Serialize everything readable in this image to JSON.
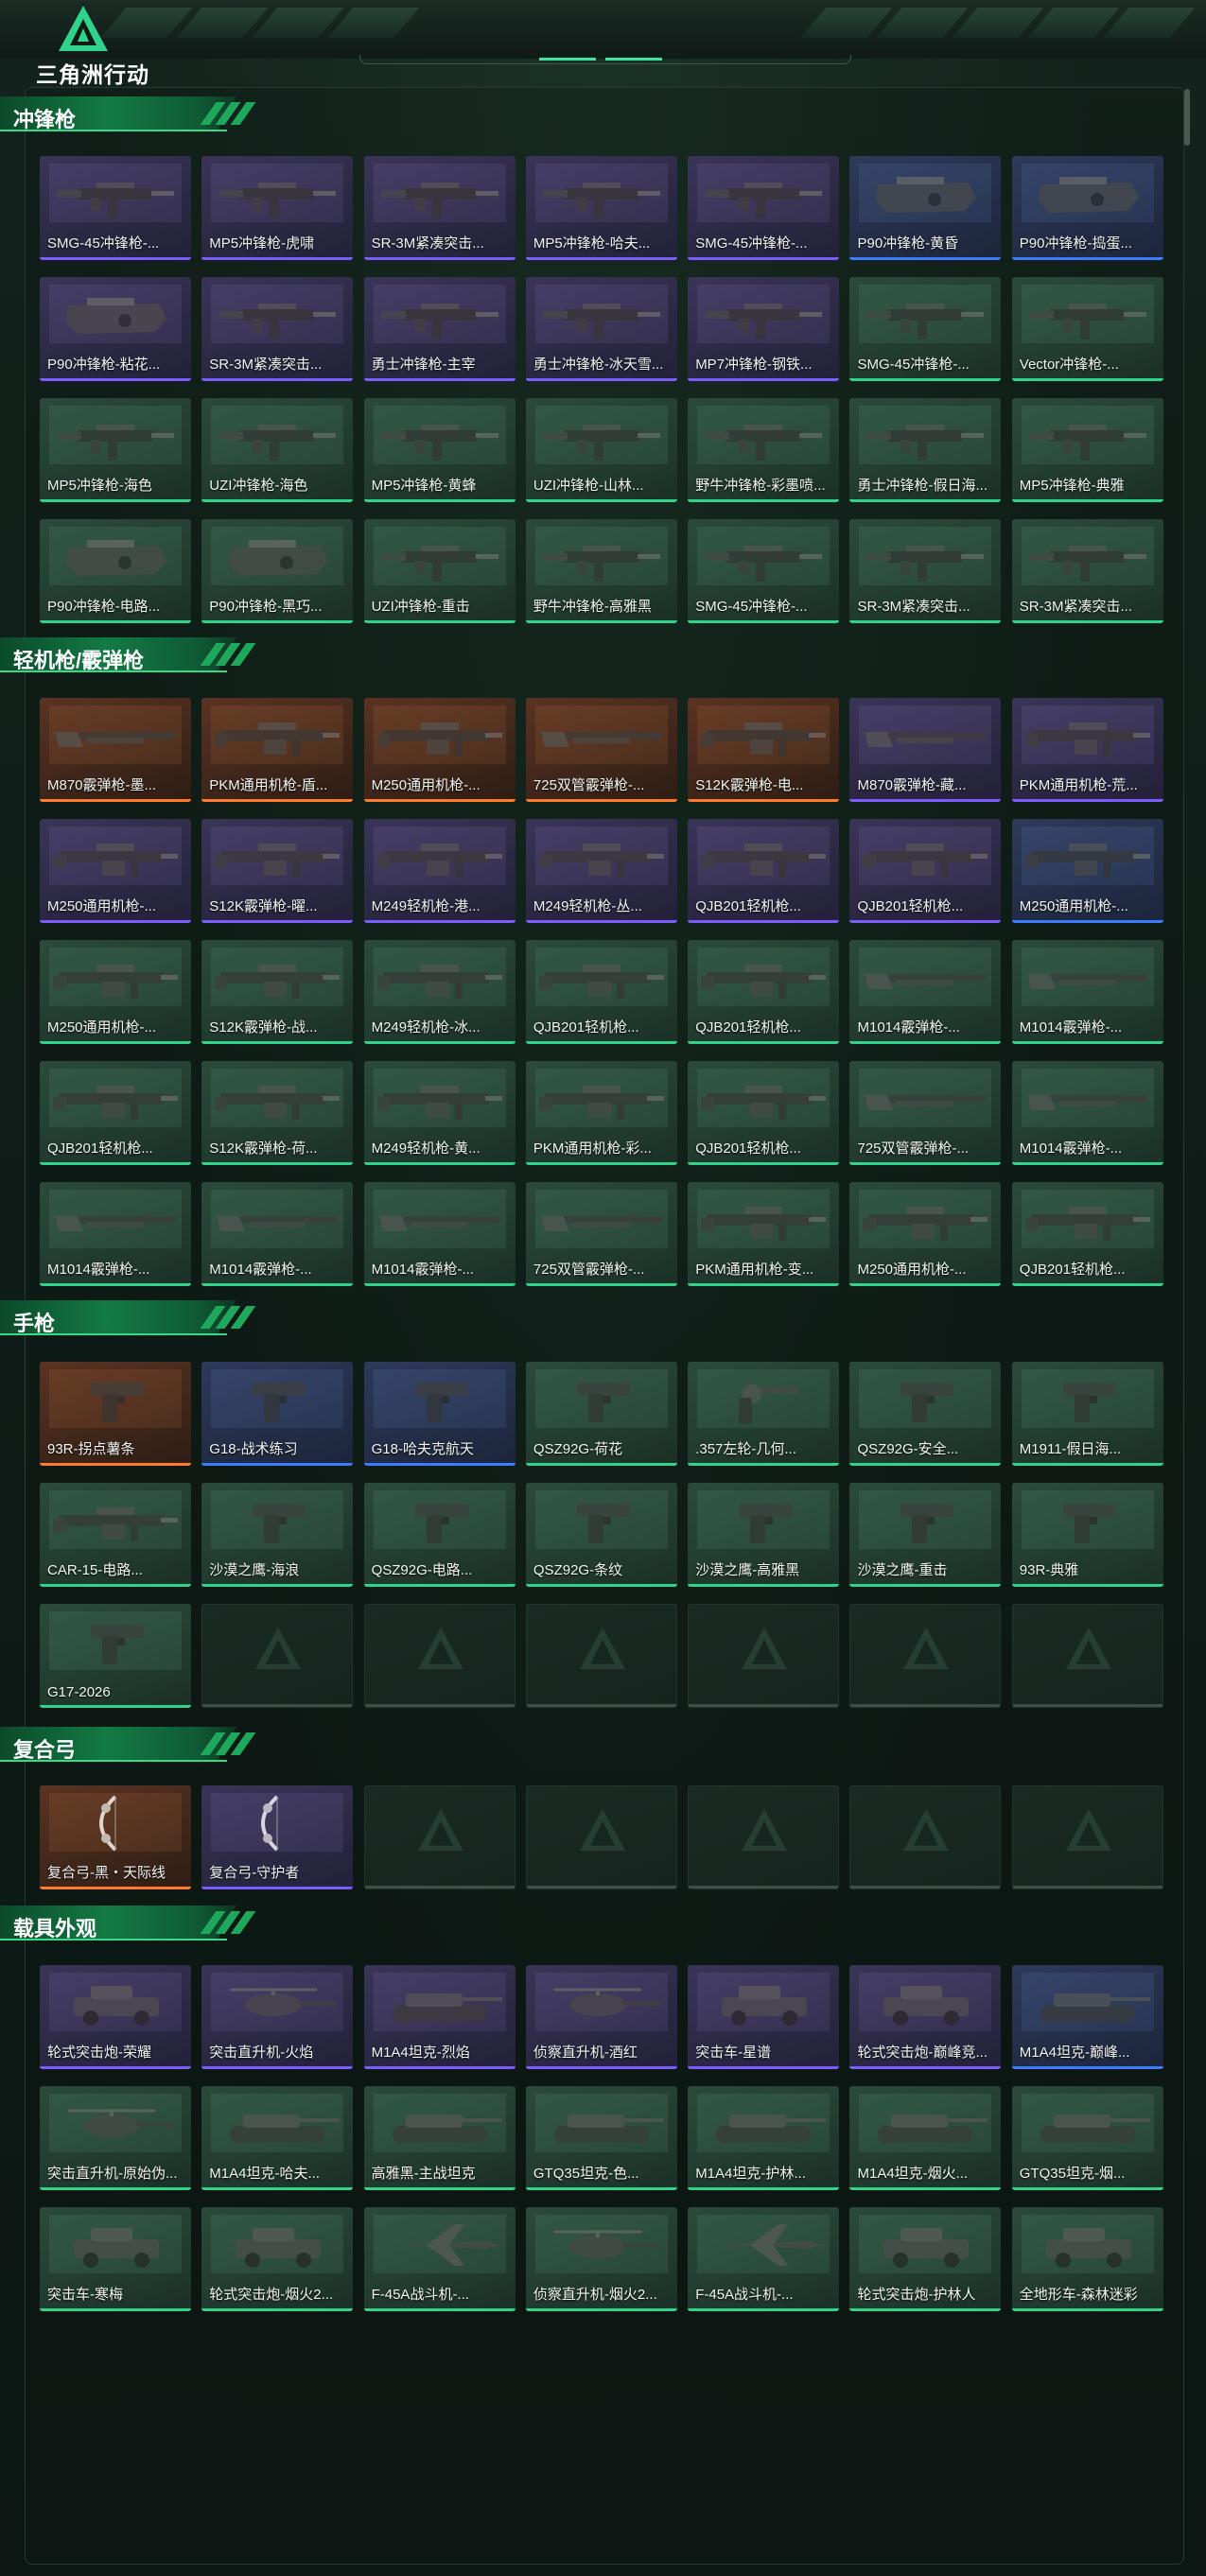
{
  "header": {
    "logo_text": "三角洲行动"
  },
  "colors": {
    "purple": "#7a5cff",
    "green": "#2fd48a",
    "orange": "#ff7a2a",
    "blue": "#3a7cff"
  },
  "sections": [
    {
      "title": "冲锋枪",
      "items": [
        {
          "label": "SMG-45冲锋枪-...",
          "rarity": "purple",
          "kind": "smg"
        },
        {
          "label": "MP5冲锋枪-虎啸",
          "rarity": "purple",
          "kind": "smg"
        },
        {
          "label": "SR-3M紧凑突击...",
          "rarity": "purple",
          "kind": "smg"
        },
        {
          "label": "MP5冲锋枪-哈夫...",
          "rarity": "purple",
          "kind": "smg"
        },
        {
          "label": "SMG-45冲锋枪-...",
          "rarity": "purple",
          "kind": "smg"
        },
        {
          "label": "P90冲锋枪-黄昏",
          "rarity": "blue",
          "kind": "p90"
        },
        {
          "label": "P90冲锋枪-捣蛋...",
          "rarity": "blue",
          "kind": "p90"
        },
        {
          "label": "P90冲锋枪-粘花...",
          "rarity": "purple",
          "kind": "p90"
        },
        {
          "label": "SR-3M紧凑突击...",
          "rarity": "purple",
          "kind": "smg"
        },
        {
          "label": "勇士冲锋枪-主宰",
          "rarity": "purple",
          "kind": "smg"
        },
        {
          "label": "勇士冲锋枪-冰天雪...",
          "rarity": "purple",
          "kind": "smg"
        },
        {
          "label": "MP7冲锋枪-钢铁...",
          "rarity": "purple",
          "kind": "smg"
        },
        {
          "label": "SMG-45冲锋枪-...",
          "rarity": "green",
          "kind": "smg"
        },
        {
          "label": "Vector冲锋枪-...",
          "rarity": "green",
          "kind": "smg"
        },
        {
          "label": "MP5冲锋枪-海色",
          "rarity": "green",
          "kind": "smg"
        },
        {
          "label": "UZI冲锋枪-海色",
          "rarity": "green",
          "kind": "smg"
        },
        {
          "label": "MP5冲锋枪-黄蜂",
          "rarity": "green",
          "kind": "smg"
        },
        {
          "label": "UZI冲锋枪-山林...",
          "rarity": "green",
          "kind": "smg"
        },
        {
          "label": "野牛冲锋枪-彩墨喷...",
          "rarity": "green",
          "kind": "smg"
        },
        {
          "label": "勇士冲锋枪-假日海...",
          "rarity": "green",
          "kind": "smg"
        },
        {
          "label": "MP5冲锋枪-典雅",
          "rarity": "green",
          "kind": "smg"
        },
        {
          "label": "P90冲锋枪-电路...",
          "rarity": "green",
          "kind": "p90"
        },
        {
          "label": "P90冲锋枪-黑巧...",
          "rarity": "green",
          "kind": "p90"
        },
        {
          "label": "UZI冲锋枪-重击",
          "rarity": "green",
          "kind": "smg"
        },
        {
          "label": "野牛冲锋枪-高雅黑",
          "rarity": "green",
          "kind": "smg"
        },
        {
          "label": "SMG-45冲锋枪-...",
          "rarity": "green",
          "kind": "smg"
        },
        {
          "label": "SR-3M紧凑突击...",
          "rarity": "green",
          "kind": "smg"
        },
        {
          "label": "SR-3M紧凑突击...",
          "rarity": "green",
          "kind": "smg"
        }
      ]
    },
    {
      "title": "轻机枪/霰弹枪",
      "items": [
        {
          "label": "M870霰弹枪-墨...",
          "rarity": "orange",
          "kind": "shotgun"
        },
        {
          "label": "PKM通用机枪-盾...",
          "rarity": "orange",
          "kind": "lmg"
        },
        {
          "label": "M250通用机枪-...",
          "rarity": "orange",
          "kind": "lmg"
        },
        {
          "label": "725双管霰弹枪-...",
          "rarity": "orange",
          "kind": "shotgun"
        },
        {
          "label": "S12K霰弹枪-电...",
          "rarity": "orange",
          "kind": "lmg"
        },
        {
          "label": "M870霰弹枪-藏...",
          "rarity": "purple",
          "kind": "shotgun"
        },
        {
          "label": "PKM通用机枪-荒...",
          "rarity": "purple",
          "kind": "lmg"
        },
        {
          "label": "M250通用机枪-...",
          "rarity": "purple",
          "kind": "lmg"
        },
        {
          "label": "S12K霰弹枪-曜...",
          "rarity": "purple",
          "kind": "lmg"
        },
        {
          "label": "M249轻机枪-港...",
          "rarity": "purple",
          "kind": "lmg"
        },
        {
          "label": "M249轻机枪-丛...",
          "rarity": "purple",
          "kind": "lmg"
        },
        {
          "label": "QJB201轻机枪...",
          "rarity": "purple",
          "kind": "lmg"
        },
        {
          "label": "QJB201轻机枪...",
          "rarity": "purple",
          "kind": "lmg"
        },
        {
          "label": "M250通用机枪-...",
          "rarity": "blue",
          "kind": "lmg"
        },
        {
          "label": "M250通用机枪-...",
          "rarity": "green",
          "kind": "lmg"
        },
        {
          "label": "S12K霰弹枪-战...",
          "rarity": "green",
          "kind": "lmg"
        },
        {
          "label": "M249轻机枪-冰...",
          "rarity": "green",
          "kind": "lmg"
        },
        {
          "label": "QJB201轻机枪...",
          "rarity": "green",
          "kind": "lmg"
        },
        {
          "label": "QJB201轻机枪...",
          "rarity": "green",
          "kind": "lmg"
        },
        {
          "label": "M1014霰弹枪-...",
          "rarity": "green",
          "kind": "shotgun"
        },
        {
          "label": "M1014霰弹枪-...",
          "rarity": "green",
          "kind": "shotgun"
        },
        {
          "label": "QJB201轻机枪...",
          "rarity": "green",
          "kind": "lmg"
        },
        {
          "label": "S12K霰弹枪-荷...",
          "rarity": "green",
          "kind": "lmg"
        },
        {
          "label": "M249轻机枪-黄...",
          "rarity": "green",
          "kind": "lmg"
        },
        {
          "label": "PKM通用机枪-彩...",
          "rarity": "green",
          "kind": "lmg"
        },
        {
          "label": "QJB201轻机枪...",
          "rarity": "green",
          "kind": "lmg"
        },
        {
          "label": "725双管霰弹枪-...",
          "rarity": "green",
          "kind": "shotgun"
        },
        {
          "label": "M1014霰弹枪-...",
          "rarity": "green",
          "kind": "shotgun"
        },
        {
          "label": "M1014霰弹枪-...",
          "rarity": "green",
          "kind": "shotgun"
        },
        {
          "label": "M1014霰弹枪-...",
          "rarity": "green",
          "kind": "shotgun"
        },
        {
          "label": "M1014霰弹枪-...",
          "rarity": "green",
          "kind": "shotgun"
        },
        {
          "label": "725双管霰弹枪-...",
          "rarity": "green",
          "kind": "shotgun"
        },
        {
          "label": "PKM通用机枪-变...",
          "rarity": "green",
          "kind": "lmg"
        },
        {
          "label": "M250通用机枪-...",
          "rarity": "green",
          "kind": "lmg"
        },
        {
          "label": "QJB201轻机枪...",
          "rarity": "green",
          "kind": "lmg"
        }
      ]
    },
    {
      "title": "手枪",
      "items": [
        {
          "label": "93R-拐点薯条",
          "rarity": "orange",
          "kind": "pistol"
        },
        {
          "label": "G18-战术练习",
          "rarity": "blue",
          "kind": "pistol"
        },
        {
          "label": "G18-哈夫克航天",
          "rarity": "blue",
          "kind": "pistol"
        },
        {
          "label": "QSZ92G-荷花",
          "rarity": "green",
          "kind": "pistol"
        },
        {
          "label": ".357左轮-几何...",
          "rarity": "green",
          "kind": "revolver"
        },
        {
          "label": "QSZ92G-安全...",
          "rarity": "green",
          "kind": "pistol"
        },
        {
          "label": "M1911-假日海...",
          "rarity": "green",
          "kind": "pistol"
        },
        {
          "label": "CAR-15-电路...",
          "rarity": "green",
          "kind": "lmg"
        },
        {
          "label": "沙漠之鹰-海浪",
          "rarity": "green",
          "kind": "pistol"
        },
        {
          "label": "QSZ92G-电路...",
          "rarity": "green",
          "kind": "pistol"
        },
        {
          "label": "QSZ92G-条纹",
          "rarity": "green",
          "kind": "pistol"
        },
        {
          "label": "沙漠之鹰-高雅黑",
          "rarity": "green",
          "kind": "pistol"
        },
        {
          "label": "沙漠之鹰-重击",
          "rarity": "green",
          "kind": "pistol"
        },
        {
          "label": "93R-典雅",
          "rarity": "green",
          "kind": "pistol"
        },
        {
          "label": "G17-2026",
          "rarity": "green",
          "kind": "pistol"
        },
        {
          "label": "",
          "rarity": "empty",
          "kind": "empty"
        },
        {
          "label": "",
          "rarity": "empty",
          "kind": "empty"
        },
        {
          "label": "",
          "rarity": "empty",
          "kind": "empty"
        },
        {
          "label": "",
          "rarity": "empty",
          "kind": "empty"
        },
        {
          "label": "",
          "rarity": "empty",
          "kind": "empty"
        },
        {
          "label": "",
          "rarity": "empty",
          "kind": "empty"
        }
      ]
    },
    {
      "title": "复合弓",
      "items": [
        {
          "label": "复合弓-黑・天际线",
          "rarity": "orange",
          "kind": "bow"
        },
        {
          "label": "复合弓-守护者",
          "rarity": "purple",
          "kind": "bow"
        },
        {
          "label": "",
          "rarity": "empty",
          "kind": "empty"
        },
        {
          "label": "",
          "rarity": "empty",
          "kind": "empty"
        },
        {
          "label": "",
          "rarity": "empty",
          "kind": "empty"
        },
        {
          "label": "",
          "rarity": "empty",
          "kind": "empty"
        },
        {
          "label": "",
          "rarity": "empty",
          "kind": "empty"
        }
      ]
    },
    {
      "title": "载具外观",
      "items": [
        {
          "label": "轮式突击炮-荣耀",
          "rarity": "purple",
          "kind": "car"
        },
        {
          "label": "突击直升机-火焰",
          "rarity": "purple",
          "kind": "heli"
        },
        {
          "label": "M1A4坦克-烈焰",
          "rarity": "purple",
          "kind": "tank"
        },
        {
          "label": "侦察直升机-酒红",
          "rarity": "purple",
          "kind": "heli"
        },
        {
          "label": "突击车-星谱",
          "rarity": "purple",
          "kind": "car"
        },
        {
          "label": "轮式突击炮-巅峰竞...",
          "rarity": "purple",
          "kind": "car"
        },
        {
          "label": "M1A4坦克-巅峰...",
          "rarity": "blue",
          "kind": "tank"
        },
        {
          "label": "突击直升机-原始伪...",
          "rarity": "green",
          "kind": "heli"
        },
        {
          "label": "M1A4坦克-哈夫...",
          "rarity": "green",
          "kind": "tank"
        },
        {
          "label": "高雅黑-主战坦克",
          "rarity": "green",
          "kind": "tank"
        },
        {
          "label": "GTQ35坦克-色...",
          "rarity": "green",
          "kind": "tank"
        },
        {
          "label": "M1A4坦克-护林...",
          "rarity": "green",
          "kind": "tank"
        },
        {
          "label": "M1A4坦克-烟火...",
          "rarity": "green",
          "kind": "tank"
        },
        {
          "label": "GTQ35坦克-烟...",
          "rarity": "green",
          "kind": "tank"
        },
        {
          "label": "突击车-寒梅",
          "rarity": "green",
          "kind": "car"
        },
        {
          "label": "轮式突击炮-烟火2...",
          "rarity": "green",
          "kind": "car"
        },
        {
          "label": "F-45A战斗机-...",
          "rarity": "green",
          "kind": "jet"
        },
        {
          "label": "侦察直升机-烟火2...",
          "rarity": "green",
          "kind": "heli"
        },
        {
          "label": "F-45A战斗机-...",
          "rarity": "green",
          "kind": "jet"
        },
        {
          "label": "轮式突击炮-护林人",
          "rarity": "green",
          "kind": "car"
        },
        {
          "label": "全地形车-森林迷彩",
          "rarity": "green",
          "kind": "car"
        }
      ]
    }
  ]
}
